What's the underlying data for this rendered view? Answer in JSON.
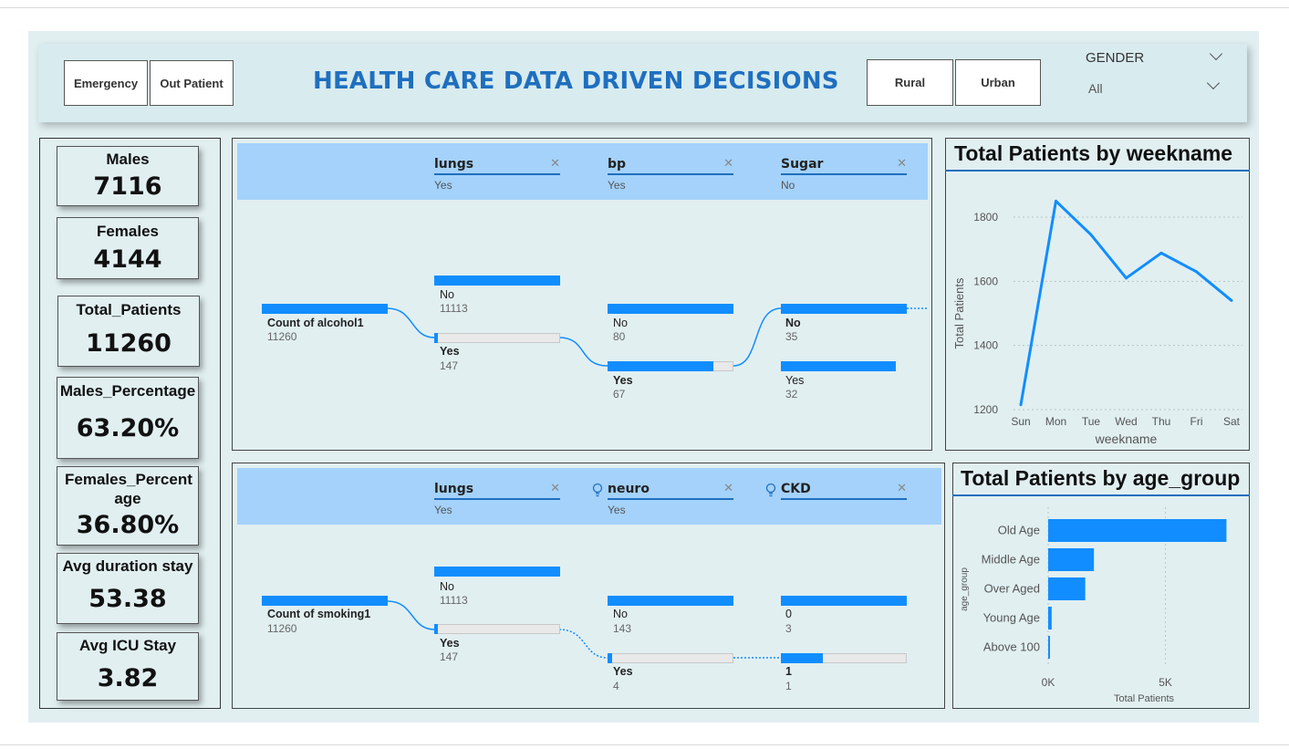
{
  "header": {
    "title": "HEALTH CARE DATA DRIVEN DECISIONS",
    "buttons_left": [
      "Emergency",
      "Out Patient"
    ],
    "buttons_right": [
      "Rural",
      "Urban"
    ],
    "gender_slicer": {
      "label": "GENDER",
      "value": "All"
    }
  },
  "kpis": [
    {
      "label": "Males",
      "value": "7116"
    },
    {
      "label": "Females",
      "value": "4144"
    },
    {
      "label": "Total_Patients",
      "value": "11260"
    },
    {
      "label": "Males_Percentage",
      "value": "63.20%"
    },
    {
      "label": "Females_Percent age",
      "value": "36.80%"
    },
    {
      "label": "Avg duration stay",
      "value": "53.38"
    },
    {
      "label": "Avg ICU Stay",
      "value": "3.82"
    }
  ],
  "tree1": {
    "levels": [
      {
        "name": "lungs",
        "selection": "Yes"
      },
      {
        "name": "bp",
        "selection": "Yes"
      },
      {
        "name": "Sugar",
        "selection": "No"
      }
    ],
    "root": {
      "label": "Count of alcohol1",
      "value": "11260"
    },
    "nodes": {
      "l1_no": {
        "label": "No",
        "value": "11113"
      },
      "l1_yes": {
        "label": "Yes",
        "value": "147"
      },
      "l2_no": {
        "label": "No",
        "value": "80"
      },
      "l2_yes": {
        "label": "Yes",
        "value": "67"
      },
      "l3_no": {
        "label": "No",
        "value": "35"
      },
      "l3_yes": {
        "label": "Yes",
        "value": "32"
      }
    }
  },
  "tree2": {
    "levels": [
      {
        "name": "lungs",
        "selection": "Yes"
      },
      {
        "name": "neuro",
        "selection": "Yes"
      },
      {
        "name": "CKD",
        "selection": ""
      }
    ],
    "root": {
      "label": "Count of smoking1",
      "value": "11260"
    },
    "nodes": {
      "l1_no": {
        "label": "No",
        "value": "11113"
      },
      "l1_yes": {
        "label": "Yes",
        "value": "147"
      },
      "l2_no": {
        "label": "No",
        "value": "143"
      },
      "l2_yes": {
        "label": "Yes",
        "value": "4"
      },
      "l3_0": {
        "label": "0",
        "value": "3"
      },
      "l3_1": {
        "label": "1",
        "value": "1"
      }
    }
  },
  "chart_data": [
    {
      "type": "line",
      "title": "Total Patients by weekname",
      "xlabel": "weekname",
      "ylabel": "Total Patients",
      "categories": [
        "Sun",
        "Mon",
        "Tue",
        "Wed",
        "Thu",
        "Fri",
        "Sat"
      ],
      "values": [
        1215,
        1850,
        1745,
        1610,
        1688,
        1630,
        1540
      ],
      "ylim": [
        1200,
        1800
      ],
      "yticks": [
        1200,
        1400,
        1600,
        1800
      ],
      "grid": true,
      "color": "#118dff"
    },
    {
      "type": "bar",
      "orientation": "horizontal",
      "title": "Total Patients by age_group",
      "xlabel": "Total Patients",
      "ylabel": "age_group",
      "categories": [
        "Old Age",
        "Middle Age",
        "Over Aged",
        "Young Age",
        "Above 100"
      ],
      "values": [
        7600,
        1950,
        1580,
        150,
        60
      ],
      "xticks": [
        "0K",
        "5K"
      ],
      "xlim": [
        0,
        7700
      ],
      "color": "#118dff"
    }
  ]
}
